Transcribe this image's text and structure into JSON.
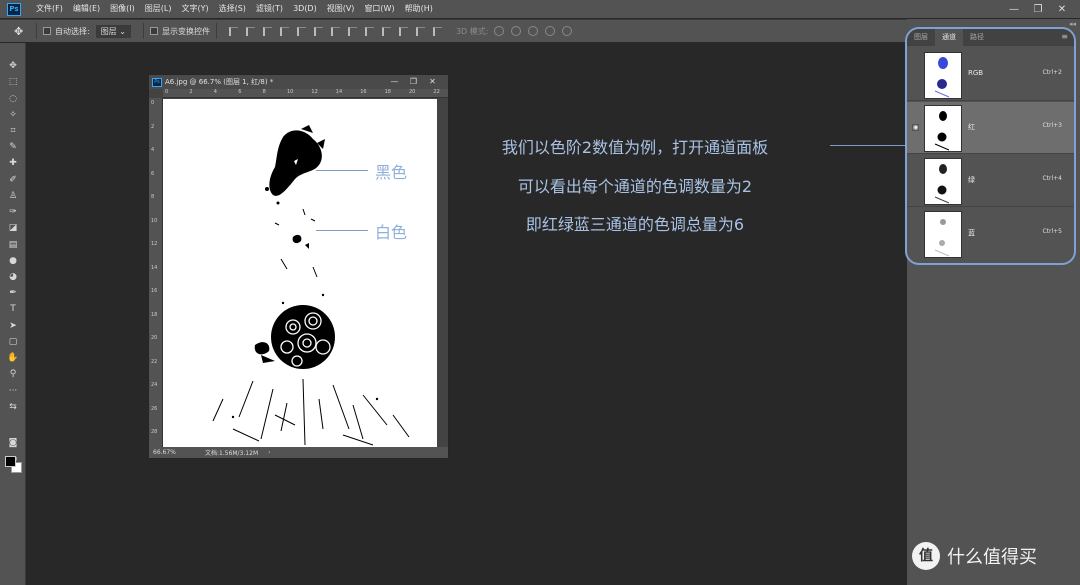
{
  "menubar": {
    "logo": "Ps",
    "items": [
      "文件(F)",
      "编辑(E)",
      "图像(I)",
      "图层(L)",
      "文字(Y)",
      "选择(S)",
      "滤镜(T)",
      "3D(D)",
      "视图(V)",
      "窗口(W)",
      "帮助(H)"
    ],
    "window_controls": [
      "—",
      "❐",
      "✕"
    ]
  },
  "options_bar": {
    "auto_select_label": "自动选择:",
    "auto_select_value": "图层",
    "show_transform_label": "显示变换控件",
    "mode_3d_label": "3D 模式:"
  },
  "document": {
    "title": "A6.jpg @ 66.7% (图层 1, 红/8) *",
    "zoom": "66.67%",
    "doc_info": "文档:1.56M/3.12M",
    "ruler_top": [
      "0",
      "2",
      "4",
      "6",
      "8",
      "10",
      "12",
      "14",
      "16",
      "18",
      "20",
      "22"
    ],
    "ruler_left": [
      "0",
      "2",
      "4",
      "6",
      "8",
      "10",
      "12",
      "14",
      "16",
      "18",
      "20",
      "22",
      "24",
      "26",
      "28"
    ]
  },
  "annotations": {
    "black_label": "黑色",
    "white_label": "白色",
    "lines": [
      "我们以色阶2数值为例，打开通道面板",
      "可以看出每个通道的色调数量为2",
      "即红绿蓝三通道的色调总量为6"
    ]
  },
  "channels_panel": {
    "tabs": [
      "图层",
      "通道",
      "路径"
    ],
    "active_tab": "通道",
    "channels": [
      {
        "name": "RGB",
        "shortcut": "Ctrl+2",
        "visible": false,
        "selected": false
      },
      {
        "name": "红",
        "shortcut": "Ctrl+3",
        "visible": true,
        "selected": true
      },
      {
        "name": "绿",
        "shortcut": "Ctrl+4",
        "visible": false,
        "selected": false
      },
      {
        "name": "蓝",
        "shortcut": "Ctrl+5",
        "visible": false,
        "selected": false
      }
    ]
  },
  "watermark": {
    "badge": "值",
    "text": "什么值得买"
  },
  "colors": {
    "accent_blue": "#7fa1d4",
    "annotation_text": "#a9c2e4",
    "workspace": "#282828",
    "panel": "#535353"
  }
}
